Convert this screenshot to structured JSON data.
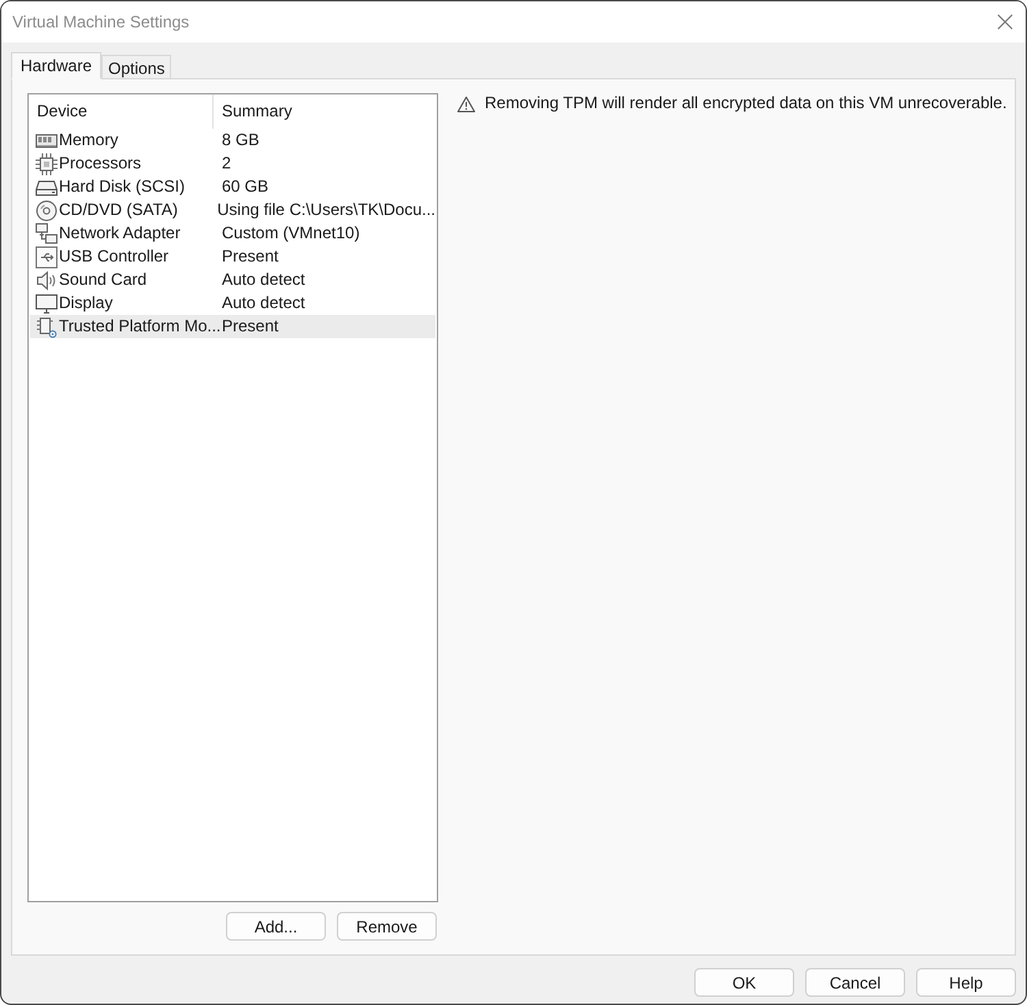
{
  "window": {
    "title": "Virtual Machine Settings"
  },
  "tabs": [
    {
      "label": "Hardware",
      "selected": true
    },
    {
      "label": "Options",
      "selected": false
    }
  ],
  "device_table": {
    "columns": [
      "Device",
      "Summary"
    ],
    "rows": [
      {
        "kind": "memory",
        "device": "Memory",
        "summary": "8 GB",
        "selected": false
      },
      {
        "kind": "processor",
        "device": "Processors",
        "summary": "2",
        "selected": false
      },
      {
        "kind": "disk",
        "device": "Hard Disk (SCSI)",
        "summary": "60 GB",
        "selected": false
      },
      {
        "kind": "cdrom",
        "device": "CD/DVD (SATA)",
        "summary": "Using file C:\\Users\\TK\\Docu...",
        "selected": false
      },
      {
        "kind": "network",
        "device": "Network Adapter",
        "summary": "Custom (VMnet10)",
        "selected": false
      },
      {
        "kind": "usb",
        "device": "USB Controller",
        "summary": "Present",
        "selected": false
      },
      {
        "kind": "sound",
        "device": "Sound Card",
        "summary": "Auto detect",
        "selected": false
      },
      {
        "kind": "display",
        "device": "Display",
        "summary": "Auto detect",
        "selected": false
      },
      {
        "kind": "tpm",
        "device": "Trusted Platform Mo...",
        "summary": "Present",
        "selected": true
      }
    ]
  },
  "list_buttons": [
    "Add...",
    "Remove"
  ],
  "warning": {
    "text": "Removing TPM will render all encrypted data on this VM unrecoverable."
  },
  "dialog_buttons": [
    "OK",
    "Cancel",
    "Help"
  ]
}
